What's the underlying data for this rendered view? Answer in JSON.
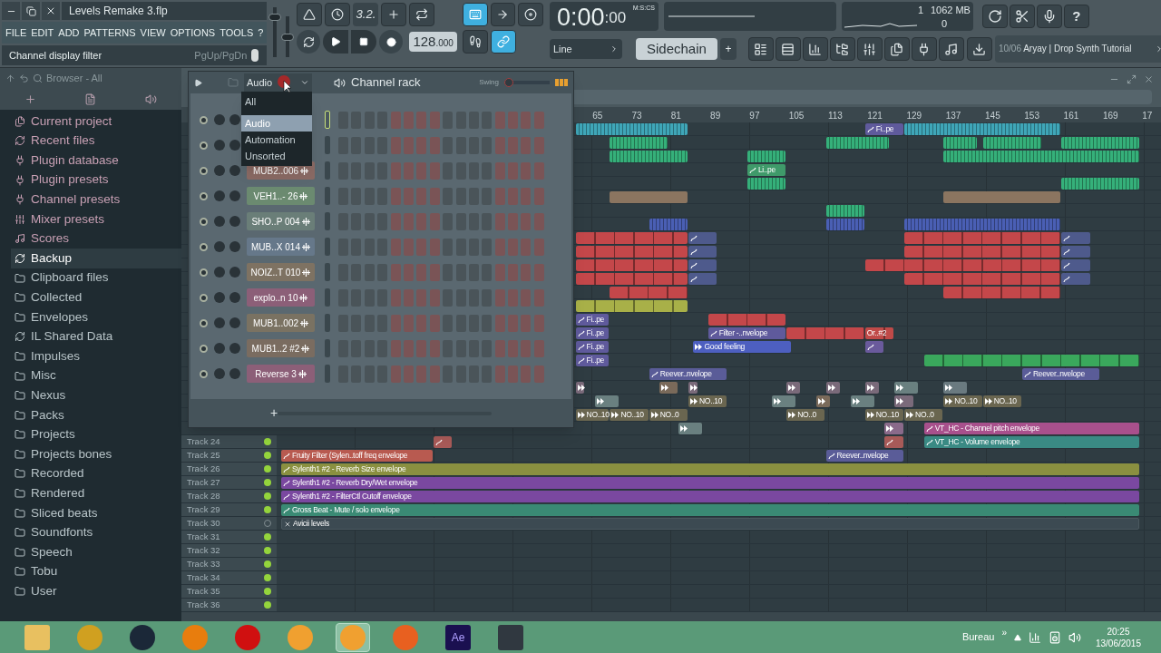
{
  "window": {
    "title": "Levels Remake 3.flp"
  },
  "menu": [
    "FILE",
    "EDIT",
    "ADD",
    "PATTERNS",
    "VIEW",
    "OPTIONS",
    "TOOLS",
    "?"
  ],
  "hint_bar": {
    "text": "Channel display filter",
    "shortcut": "PgUp/PgDn"
  },
  "master_sliders": [
    {
      "kind": "volume",
      "level": 0.85
    },
    {
      "kind": "pitch",
      "level": 0.5
    }
  ],
  "transport": {
    "countdown": "3.2.",
    "tempo": "128",
    "tempo_decimals": ".000"
  },
  "record_toggles": [
    {
      "kind": "keyboard",
      "on": true
    },
    {
      "kind": "step",
      "on": false
    },
    {
      "kind": "link",
      "on": true
    }
  ],
  "snap": {
    "value": "Line"
  },
  "help": "?",
  "time": {
    "main": "0:00",
    "small": ":00",
    "format": "M:S:CS"
  },
  "monitor": {
    "cpu": "1",
    "memory": "1062 MB",
    "polyphony": "0"
  },
  "pattern": {
    "name": "Sidechain",
    "add": "+"
  },
  "news": {
    "date": "10/06",
    "title": "Aryay | Drop Synth Tutorial"
  },
  "browser": {
    "title": "Browser - All",
    "items": [
      {
        "label": "Current project",
        "kind": "project",
        "selected": false
      },
      {
        "label": "Recent files",
        "kind": "recent",
        "selected": false
      },
      {
        "label": "Plugin database",
        "kind": "plugin",
        "selected": false
      },
      {
        "label": "Plugin presets",
        "kind": "plugin",
        "selected": false
      },
      {
        "label": "Channel presets",
        "kind": "channel",
        "selected": false
      },
      {
        "label": "Mixer presets",
        "kind": "mixer",
        "selected": false
      },
      {
        "label": "Scores",
        "kind": "score",
        "selected": false
      },
      {
        "label": "Backup",
        "kind": "recent",
        "selected": true
      },
      {
        "label": "Clipboard files",
        "kind": "folder",
        "selected": false
      },
      {
        "label": "Collected",
        "kind": "folder",
        "selected": false
      },
      {
        "label": "Envelopes",
        "kind": "folder",
        "selected": false
      },
      {
        "label": "IL Shared Data",
        "kind": "shared",
        "selected": false
      },
      {
        "label": "Impulses",
        "kind": "folder",
        "selected": false
      },
      {
        "label": "Misc",
        "kind": "folder",
        "selected": false
      },
      {
        "label": "Nexus",
        "kind": "folder",
        "selected": false
      },
      {
        "label": "Packs",
        "kind": "folder",
        "selected": false
      },
      {
        "label": "Projects",
        "kind": "folder",
        "selected": false
      },
      {
        "label": "Projects bones",
        "kind": "folder",
        "selected": false
      },
      {
        "label": "Recorded",
        "kind": "folder",
        "selected": false
      },
      {
        "label": "Rendered",
        "kind": "folder",
        "selected": false
      },
      {
        "label": "Sliced beats",
        "kind": "folder",
        "selected": false
      },
      {
        "label": "Soundfonts",
        "kind": "folder",
        "selected": false
      },
      {
        "label": "Speech",
        "kind": "folder",
        "selected": false
      },
      {
        "label": "Tobu",
        "kind": "folder",
        "selected": false
      },
      {
        "label": "User",
        "kind": "folder",
        "selected": false
      }
    ]
  },
  "channel_rack": {
    "title": "Channel rack",
    "filter": "Audio",
    "swing_label": "Swing",
    "swing": {
      "level": 0
    },
    "add": "+",
    "filter_menu": [
      {
        "label": "All",
        "selected": false
      },
      {
        "label": "Audio",
        "selected": true
      },
      {
        "label": "Automation",
        "selected": false
      },
      {
        "label": "Unsorted",
        "selected": false
      }
    ],
    "channels": [
      {
        "selected": true
      },
      {
        "selected": false
      },
      {
        "name": "MUB2..006",
        "color": "#8a6a64",
        "selected": false
      },
      {
        "name": "VEH1..- 26",
        "color": "#6b8a70",
        "selected": false
      },
      {
        "name": "SHO..P 004",
        "color": "#6a7e78",
        "selected": false
      },
      {
        "name": "MUB..X 014",
        "color": "#66788a",
        "selected": false
      },
      {
        "name": "NOIZ..T 010",
        "color": "#7e7262",
        "selected": false
      },
      {
        "name": "explo..n 10",
        "color": "#8c5f78",
        "selected": false
      },
      {
        "name": "MUB1..002",
        "color": "#7a7262",
        "selected": false
      },
      {
        "name": "MUB1..2 #2",
        "color": "#7a6c60",
        "selected": false
      },
      {
        "name": "Reverse 3",
        "color": "#8c5f78",
        "selected": false
      }
    ]
  },
  "playlist": {
    "ruler": [
      "65",
      "73",
      "81",
      "89",
      "97",
      "105",
      "113",
      "121",
      "129",
      "137",
      "145",
      "153",
      "161",
      "169",
      "17"
    ],
    "tracks": [
      {
        "clips": [
          {
            "kind": "notes",
            "color": "#3fa6b8"
          },
          {
            "kind": "automation",
            "label": "Fi..pe",
            "color": "#5f5a9c"
          },
          {
            "kind": "notes",
            "color": "#3fa6b8"
          }
        ]
      },
      {
        "clips": [
          {
            "kind": "notes",
            "color": "#35b07a"
          },
          {
            "kind": "notes",
            "color": "#35b07a"
          },
          {
            "kind": "notes",
            "color": "#35b07a"
          },
          {
            "kind": "notes",
            "color": "#35b07a"
          },
          {
            "kind": "notes",
            "color": "#35b07a"
          }
        ]
      },
      {
        "clips": [
          {
            "kind": "notes",
            "color": "#35b07a"
          },
          {
            "kind": "notes",
            "color": "#35b07a"
          },
          {
            "kind": "notes",
            "color": "#35b07a"
          }
        ]
      },
      {
        "clips": [
          {
            "kind": "automation",
            "label": "Li..pe",
            "color": "#3f9a6a"
          }
        ]
      },
      {
        "clips": [
          {
            "kind": "notes",
            "color": "#35b07a"
          },
          {
            "kind": "notes",
            "color": "#35b07a"
          }
        ]
      },
      {
        "clips": [
          {
            "kind": "block",
            "color": "#8b7560"
          },
          {
            "kind": "block",
            "color": "#8b7560"
          }
        ]
      },
      {
        "clips": [
          {
            "kind": "notes",
            "color": "#35b07a"
          }
        ]
      },
      {
        "clips": [
          {
            "kind": "notes",
            "color": "#4a5fb4"
          },
          {
            "kind": "notes",
            "color": "#4a5fb4"
          },
          {
            "kind": "notes",
            "color": "#4a5fb4"
          }
        ]
      },
      {
        "clips": [
          {
            "kind": "pattern",
            "color": "#c4474a"
          },
          {
            "kind": "automation",
            "color": "#4e5a8c"
          },
          {
            "kind": "pattern",
            "color": "#c4474a"
          },
          {
            "kind": "automation",
            "color": "#4e5a8c"
          }
        ]
      },
      {
        "clips": [
          {
            "kind": "pattern",
            "color": "#c4474a"
          },
          {
            "kind": "automation",
            "color": "#4e5a8c"
          },
          {
            "kind": "pattern",
            "color": "#c4474a"
          },
          {
            "kind": "automation",
            "color": "#4e5a8c"
          }
        ]
      },
      {
        "clips": [
          {
            "kind": "pattern",
            "color": "#c4474a"
          },
          {
            "kind": "automation",
            "color": "#4e5a8c"
          },
          {
            "kind": "pattern",
            "color": "#c4474a"
          },
          {
            "kind": "automation",
            "color": "#4e5a8c"
          }
        ]
      },
      {
        "clips": [
          {
            "kind": "pattern",
            "color": "#c4474a"
          },
          {
            "kind": "automation",
            "color": "#4e5a8c"
          },
          {
            "kind": "pattern",
            "color": "#c4474a"
          },
          {
            "kind": "automation",
            "color": "#4e5a8c"
          }
        ]
      },
      {
        "clips": [
          {
            "kind": "pattern",
            "color": "#c4474a"
          },
          {
            "kind": "pattern",
            "color": "#c4474a"
          }
        ]
      },
      {
        "clips": [
          {
            "kind": "pattern",
            "color": "#a8b048"
          }
        ]
      },
      {
        "clips": [
          {
            "kind": "automation",
            "label": "Fi..pe",
            "color": "#5f5a9c"
          },
          {
            "kind": "pattern",
            "color": "#c4474a"
          }
        ]
      },
      {
        "clips": [
          {
            "kind": "automation",
            "label": "Fi..pe",
            "color": "#5f5a9c"
          },
          {
            "kind": "automation",
            "label": "Filter -..nvelope",
            "color": "#5f5a9c"
          },
          {
            "kind": "pattern",
            "color": "#c4474a"
          },
          {
            "kind": "pattern",
            "label": "Or..#2",
            "color": "#c04a48"
          }
        ]
      },
      {
        "clips": [
          {
            "kind": "automation",
            "label": "Fi..pe",
            "color": "#5f5a9c"
          },
          {
            "kind": "audio",
            "label": "Good feeling",
            "color": "#4d5fc0"
          },
          {
            "kind": "automation",
            "color": "#6a5a9c"
          }
        ]
      },
      {
        "clips": [
          {
            "kind": "automation",
            "label": "Fi..pe",
            "color": "#5f5a9c"
          },
          {
            "kind": "pattern",
            "color": "#3aa85c"
          }
        ]
      },
      {
        "clips": [
          {
            "kind": "automation",
            "label": "Reever..nvelope",
            "color": "#5a5c98"
          },
          {
            "kind": "automation",
            "label": "Reever..nvelope",
            "color": "#5a5c98"
          }
        ]
      },
      {
        "clips": [
          {
            "kind": "audio",
            "color": "#7a6a7a"
          },
          {
            "kind": "audio",
            "color": "#7a6a5a"
          },
          {
            "kind": "audio",
            "color": "#7a6a7a"
          },
          {
            "kind": "audio",
            "color": "#7a6a7a"
          },
          {
            "kind": "audio",
            "color": "#7a6a7a"
          },
          {
            "kind": "audio",
            "color": "#7a6a7a"
          },
          {
            "kind": "audio",
            "color": "#6a8080"
          },
          {
            "kind": "audio",
            "color": "#6a7a80"
          }
        ]
      },
      {
        "clips": [
          {
            "kind": "audio",
            "color": "#6a8080"
          },
          {
            "kind": "audio",
            "label": "NO..10",
            "color": "#6a6650"
          },
          {
            "kind": "audio",
            "color": "#6a8080"
          },
          {
            "kind": "audio",
            "color": "#7a6a5a"
          },
          {
            "kind": "audio",
            "color": "#6a8080"
          },
          {
            "kind": "audio",
            "color": "#7a6a7a"
          },
          {
            "kind": "audio",
            "label": "NO..10",
            "color": "#6a6650"
          },
          {
            "kind": "audio",
            "label": "NO..10",
            "color": "#6a6650"
          }
        ]
      },
      {
        "clips": [
          {
            "kind": "audio",
            "label": "NO..10",
            "color": "#6a6650"
          },
          {
            "kind": "audio",
            "label": "NO..10",
            "color": "#6a6650"
          },
          {
            "kind": "audio",
            "label": "NO..0",
            "color": "#6a6650"
          },
          {
            "kind": "audio",
            "label": "NO..0",
            "color": "#6a6650"
          },
          {
            "kind": "audio",
            "label": "NO..10",
            "color": "#6a6650"
          },
          {
            "kind": "audio",
            "label": "NO..0",
            "color": "#6a6650"
          }
        ]
      },
      {
        "clips": [
          {
            "kind": "audio",
            "color": "#6a8080"
          },
          {
            "kind": "audio",
            "color": "#8a6a8a"
          },
          {
            "kind": "automation",
            "label": "VT_HC - Channel pitch envelope",
            "color": "#a8508c"
          }
        ]
      },
      {
        "name": "Track 24",
        "on": true,
        "clips": [
          {
            "kind": "automation",
            "color": "#a85a58"
          },
          {
            "kind": "automation",
            "color": "#a85a58"
          },
          {
            "kind": "automation",
            "label": "VT_HC - Volume envelope",
            "color": "#3a8a84"
          }
        ]
      },
      {
        "name": "Track 25",
        "on": true,
        "clips": [
          {
            "kind": "automation",
            "label": "Fruity Filter (Sylen..toff freq envelope",
            "color": "#b85a50"
          },
          {
            "kind": "automation",
            "label": "Reever..nvelope",
            "color": "#5a5c98"
          }
        ]
      },
      {
        "name": "Track 26",
        "on": true,
        "clips": [
          {
            "kind": "automation",
            "label": "Sylenth1 #2 - Reverb Size envelope",
            "color": "#8a9040"
          }
        ]
      },
      {
        "name": "Track 27",
        "on": true,
        "clips": [
          {
            "kind": "automation",
            "label": "Sylenth1 #2 - Reverb Dry/Wet envelope",
            "color": "#7a48a0"
          }
        ]
      },
      {
        "name": "Track 28",
        "on": true,
        "clips": [
          {
            "kind": "automation",
            "label": "Sylenth1 #2 - FilterCtl Cutoff envelope",
            "color": "#7a48a0"
          }
        ]
      },
      {
        "name": "Track 29",
        "on": true,
        "clips": [
          {
            "kind": "automation",
            "label": "Gross Beat - Mute / solo envelope",
            "color": "#3a8a74"
          }
        ]
      },
      {
        "name": "Track 30",
        "on": false,
        "clips": [
          {
            "kind": "disabled",
            "label": "Avicii levels",
            "color": "#3c4a52"
          }
        ]
      },
      {
        "name": "Track 31",
        "on": true
      },
      {
        "name": "Track 32",
        "on": true
      },
      {
        "name": "Track 33",
        "on": true
      },
      {
        "name": "Track 34",
        "on": true
      },
      {
        "name": "Track 35",
        "on": true
      },
      {
        "name": "Track 36",
        "on": true
      }
    ]
  },
  "taskbar": {
    "apps": [
      {
        "kind": "folder",
        "selected": false
      },
      {
        "kind": "media",
        "selected": false
      },
      {
        "kind": "steam",
        "selected": false
      },
      {
        "kind": "blender",
        "selected": false
      },
      {
        "kind": "record",
        "selected": false
      },
      {
        "kind": "fl",
        "selected": false
      },
      {
        "kind": "fl",
        "selected": true
      },
      {
        "kind": "firefox",
        "selected": false
      },
      {
        "kind": "ae",
        "label": "Ae",
        "selected": false
      },
      {
        "kind": "app",
        "selected": false
      }
    ],
    "toolbar_label": "Bureau",
    "chevron": "»",
    "time": "20:25",
    "date": "13/06/2015"
  }
}
